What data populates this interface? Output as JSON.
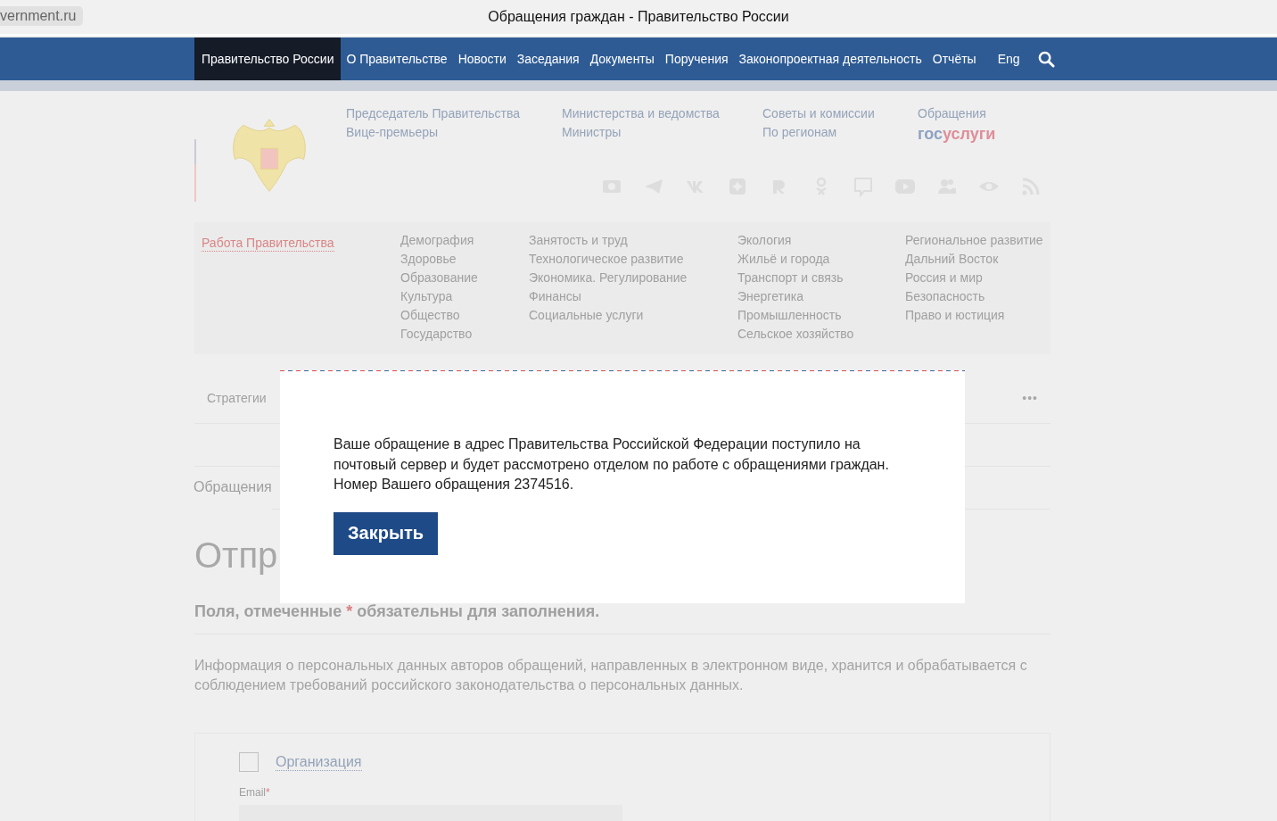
{
  "browser": {
    "address": "vernment.ru",
    "title": "Обращения граждан - Правительство России"
  },
  "nav": {
    "items": [
      {
        "label": "Правительство России",
        "selected": true
      },
      {
        "label": "О Правительстве",
        "selected": false
      },
      {
        "label": "Новости",
        "selected": false
      },
      {
        "label": "Заседания",
        "selected": false
      },
      {
        "label": "Документы",
        "selected": false
      },
      {
        "label": "Поручения",
        "selected": false
      },
      {
        "label": "Законопроектная деятельность",
        "selected": false
      },
      {
        "label": "Отчёты",
        "selected": false
      }
    ],
    "language": "Eng"
  },
  "header": {
    "columns": [
      [
        "Председатель Правительства",
        "Вице-премьеры"
      ],
      [
        "Министерства и ведомства",
        "Министры"
      ],
      [
        "Советы и комиссии",
        "По регионам"
      ],
      [
        "Обращения"
      ]
    ],
    "gosuslugi": {
      "part_1": "гос",
      "part_2": "услуги"
    }
  },
  "categories": {
    "title": "Работа Правительства",
    "columns": [
      [
        "Демография",
        "Здоровье",
        "Образование",
        "Культура",
        "Общество",
        "Государство"
      ],
      [
        "Занятость и труд",
        "Технологическое развитие",
        "Экономика. Регулирование",
        "Финансы",
        "Социальные услуги"
      ],
      [
        "Экология",
        "Жильё и города",
        "Транспорт и связь",
        "Энергетика",
        "Промышленность",
        "Сельское хозяйство"
      ],
      [
        "Региональное развитие",
        "Дальний Восток",
        "Россия и мир",
        "Безопасность",
        "Право и юстиция"
      ]
    ]
  },
  "tabs": {
    "items": [
      "Стратегии"
    ],
    "more": "•••"
  },
  "breadcrumb": "Обращения",
  "heading": "Отпр",
  "required_note": {
    "before": "Поля, отмеченные",
    "mark": "*",
    "after": "обязательны для заполнения."
  },
  "info": "Информация о персональных данных авторов обращений, направленных в электронном виде, хранится и обрабатывается с соблюдением требований российского законодательства о персональных данных.",
  "form": {
    "organization": {
      "label": "Организация",
      "checked": false
    },
    "email_label": "Email",
    "email_mark": "*"
  },
  "modal": {
    "message": "Ваше обращение в адрес Правительства Российской Федерации поступило на почтовый сервер и будет рассмотрено отделом по работе с обращениями граждан. Номер Вашего обращения 2374516.",
    "button": "Закрыть"
  }
}
